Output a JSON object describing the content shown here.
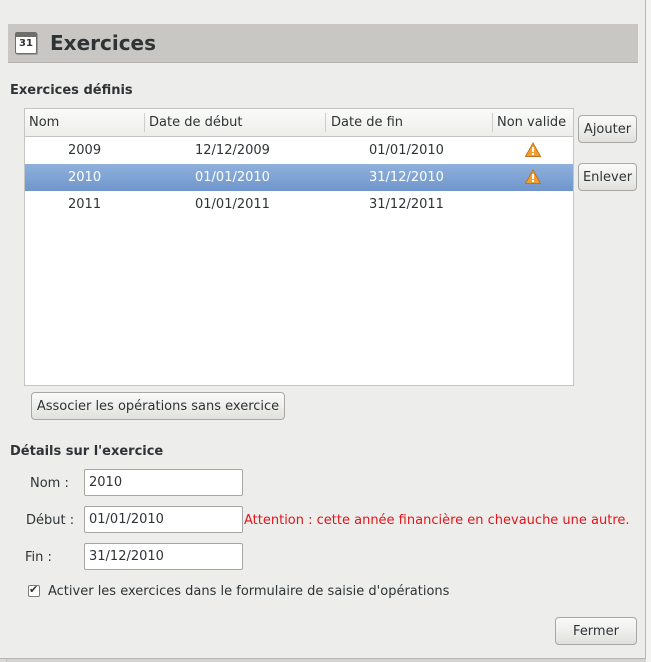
{
  "dialog": {
    "title": "Exercices",
    "icon": "calendar-icon",
    "icon_text": "31"
  },
  "exercises_section": {
    "title": "Exercices définis",
    "columns": [
      "Nom",
      "Date de début",
      "Date de fin",
      "Non valide"
    ],
    "rows": [
      {
        "name": "2009",
        "start": "12/12/2009",
        "end": "01/01/2010",
        "invalid": true,
        "selected": false
      },
      {
        "name": "2010",
        "start": "01/01/2010",
        "end": "31/12/2010",
        "invalid": true,
        "selected": true
      },
      {
        "name": "2011",
        "start": "01/01/2011",
        "end": "31/12/2011",
        "invalid": false,
        "selected": false
      }
    ],
    "add_label": "Ajouter",
    "remove_label": "Enlever",
    "associate_label": "Associer les opérations sans exercice"
  },
  "details_section": {
    "title": "Détails sur l'exercice",
    "name_label": "Nom :",
    "name_value": "2010",
    "start_label": "Début :",
    "start_value": "01/01/2010",
    "end_label": "Fin :",
    "end_value": "31/12/2010",
    "warning": "Attention : cette année financière en chevauche une autre.",
    "checkbox_label": "Activer les exercices dans le formulaire de saisie d'opérations",
    "checkbox_checked": true
  },
  "footer": {
    "close_label": "Fermer"
  },
  "colors": {
    "selection": "#7aa0d4",
    "warning_text": "#e0161c",
    "warning_icon": "#f0a030"
  }
}
